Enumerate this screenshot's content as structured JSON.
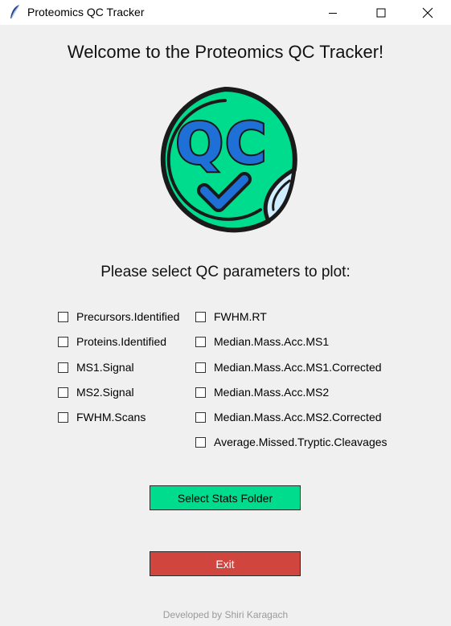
{
  "window": {
    "title": "Proteomics QC Tracker",
    "icon": "feather-icon"
  },
  "main": {
    "welcome": "Welcome to the Proteomics QC Tracker!",
    "logo_text": "QC",
    "logo_icon": "qc-sticker-checkmark-icon",
    "prompt": "Please select QC parameters to plot:"
  },
  "parameters": {
    "left": [
      {
        "label": "Precursors.Identified",
        "checked": false
      },
      {
        "label": "Proteins.Identified",
        "checked": false
      },
      {
        "label": "MS1.Signal",
        "checked": false
      },
      {
        "label": "MS2.Signal",
        "checked": false
      },
      {
        "label": "FWHM.Scans",
        "checked": false
      }
    ],
    "right": [
      {
        "label": "FWHM.RT",
        "checked": false
      },
      {
        "label": "Median.Mass.Acc.MS1",
        "checked": false
      },
      {
        "label": "Median.Mass.Acc.MS1.Corrected",
        "checked": false
      },
      {
        "label": "Median.Mass.Acc.MS2",
        "checked": false
      },
      {
        "label": "Median.Mass.Acc.MS2.Corrected",
        "checked": false
      },
      {
        "label": "Average.Missed.Tryptic.Cleavages",
        "checked": false
      }
    ]
  },
  "buttons": {
    "select_stats": "Select Stats Folder",
    "exit": "Exit"
  },
  "footer": "Developed by Shiri Karagach",
  "colors": {
    "background": "#f0f0f0",
    "accent_green": "#00dc8e",
    "exit_red": "#d0463f",
    "logo_blue": "#1e6fd6"
  }
}
